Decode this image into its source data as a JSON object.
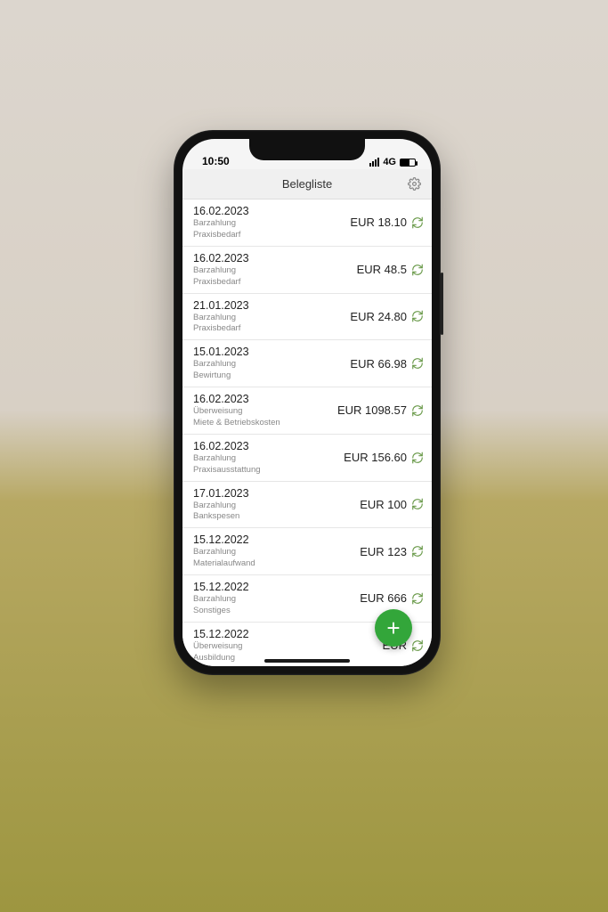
{
  "statusbar": {
    "time": "10:50",
    "network": "4G"
  },
  "header": {
    "title": "Belegliste"
  },
  "fab": {
    "label": "+"
  },
  "rows": [
    {
      "date": "16.02.2023",
      "line1": "Barzahlung",
      "line2": "Praxisbedarf",
      "amount": "EUR 18.10"
    },
    {
      "date": "16.02.2023",
      "line1": "Barzahlung",
      "line2": "Praxisbedarf",
      "amount": "EUR 48.5"
    },
    {
      "date": "21.01.2023",
      "line1": "Barzahlung",
      "line2": "Praxisbedarf",
      "amount": "EUR 24.80"
    },
    {
      "date": "15.01.2023",
      "line1": "Barzahlung",
      "line2": "Bewirtung",
      "amount": "EUR 66.98"
    },
    {
      "date": "16.02.2023",
      "line1": "Überweisung",
      "line2": "Miete & Betriebskosten",
      "amount": "EUR 1098.57"
    },
    {
      "date": "16.02.2023",
      "line1": "Barzahlung",
      "line2": "Praxisausstattung",
      "amount": "EUR 156.60"
    },
    {
      "date": "17.01.2023",
      "line1": "Barzahlung",
      "line2": "Bankspesen",
      "amount": "EUR 100"
    },
    {
      "date": "15.12.2022",
      "line1": "Barzahlung",
      "line2": "Materialaufwand",
      "amount": "EUR 123"
    },
    {
      "date": "15.12.2022",
      "line1": "Barzahlung",
      "line2": "Sonstiges",
      "amount": "EUR 666"
    },
    {
      "date": "15.12.2022",
      "line1": "Überweisung",
      "line2": "Ausbildung",
      "amount": "EUR"
    }
  ]
}
